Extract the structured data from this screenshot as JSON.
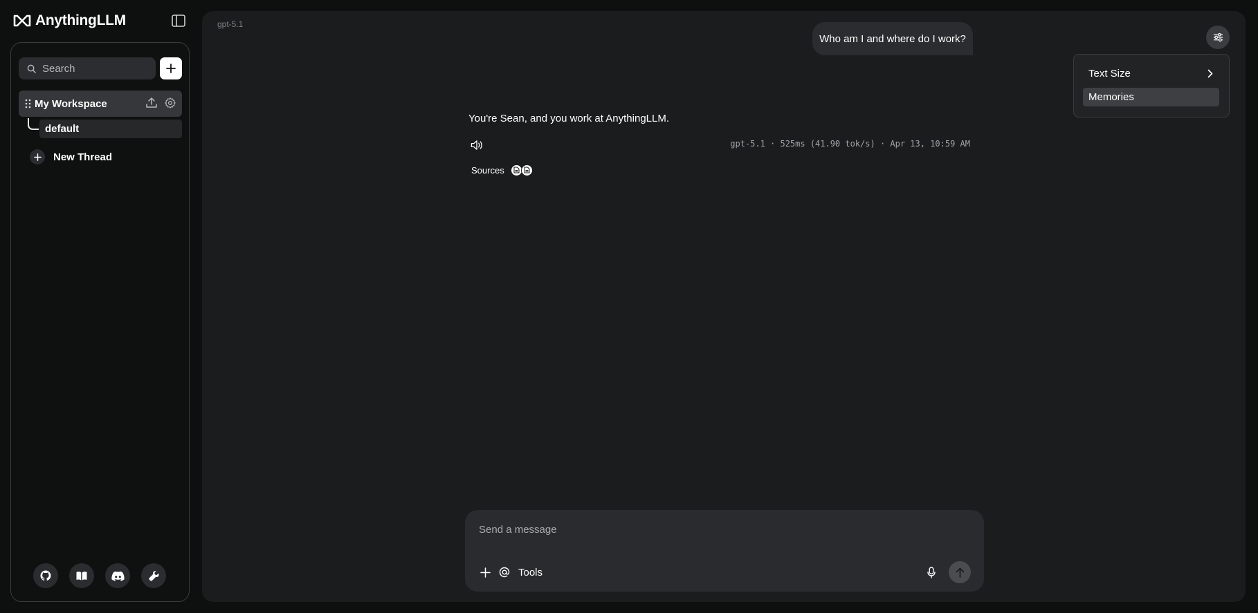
{
  "app": {
    "name": "AnythingLLM"
  },
  "sidebar": {
    "search_placeholder": "Search",
    "workspace": {
      "name": "My Workspace"
    },
    "threads": [
      {
        "name": "default"
      }
    ],
    "new_thread_label": "New Thread",
    "footer_icons": [
      "github-icon",
      "docs-book-icon",
      "discord-icon",
      "settings-wrench-icon"
    ]
  },
  "chat": {
    "model_label": "gpt-5.1",
    "user_message": "Who am I and where do I work?",
    "assistant_message": "You're Sean, and you work at AnythingLLM.",
    "meta": "gpt-5.1 · 525ms (41.90 tok/s) · Apr 13, 10:59 AM",
    "sources_label": "Sources",
    "source_count": 2
  },
  "settings_menu": {
    "items": [
      {
        "label": "Text Size",
        "has_submenu": true
      },
      {
        "label": "Memories",
        "highlighted": true
      }
    ]
  },
  "composer": {
    "placeholder": "Send a message",
    "tools_label": "Tools"
  },
  "colors": {
    "app_background": "#0e0f0f",
    "main_panel": "#1b1c1e",
    "bubble": "#2b2c2f",
    "highlight": "#3d3f42"
  }
}
